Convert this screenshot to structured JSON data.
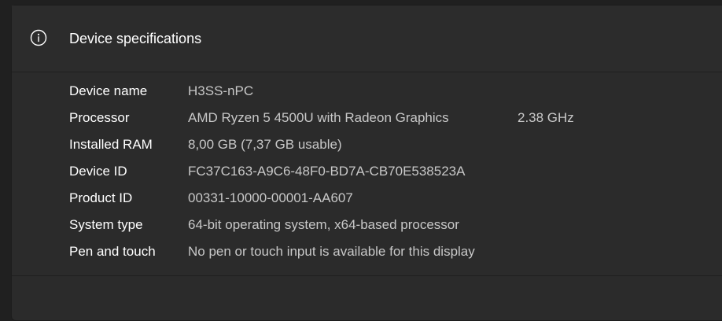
{
  "section": {
    "title": "Device specifications",
    "icon": "info-icon"
  },
  "specs": [
    {
      "label": "Device name",
      "value": "H3SS-nPC",
      "extra": ""
    },
    {
      "label": "Processor",
      "value": "AMD Ryzen 5 4500U with Radeon Graphics",
      "extra": "2.38 GHz"
    },
    {
      "label": "Installed RAM",
      "value": "8,00 GB (7,37 GB usable)",
      "extra": ""
    },
    {
      "label": "Device ID",
      "value": "FC37C163-A9C6-48F0-BD7A-CB70E538523A",
      "extra": ""
    },
    {
      "label": "Product ID",
      "value": "00331-10000-00001-AA607",
      "extra": ""
    },
    {
      "label": "System type",
      "value": "64-bit operating system, x64-based processor",
      "extra": ""
    },
    {
      "label": "Pen and touch",
      "value": "No pen or touch input is available for this display",
      "extra": ""
    }
  ],
  "colors": {
    "background": "#202020",
    "card": "#2b2b2b",
    "label": "#ffffff",
    "value": "#c8c8c8"
  }
}
